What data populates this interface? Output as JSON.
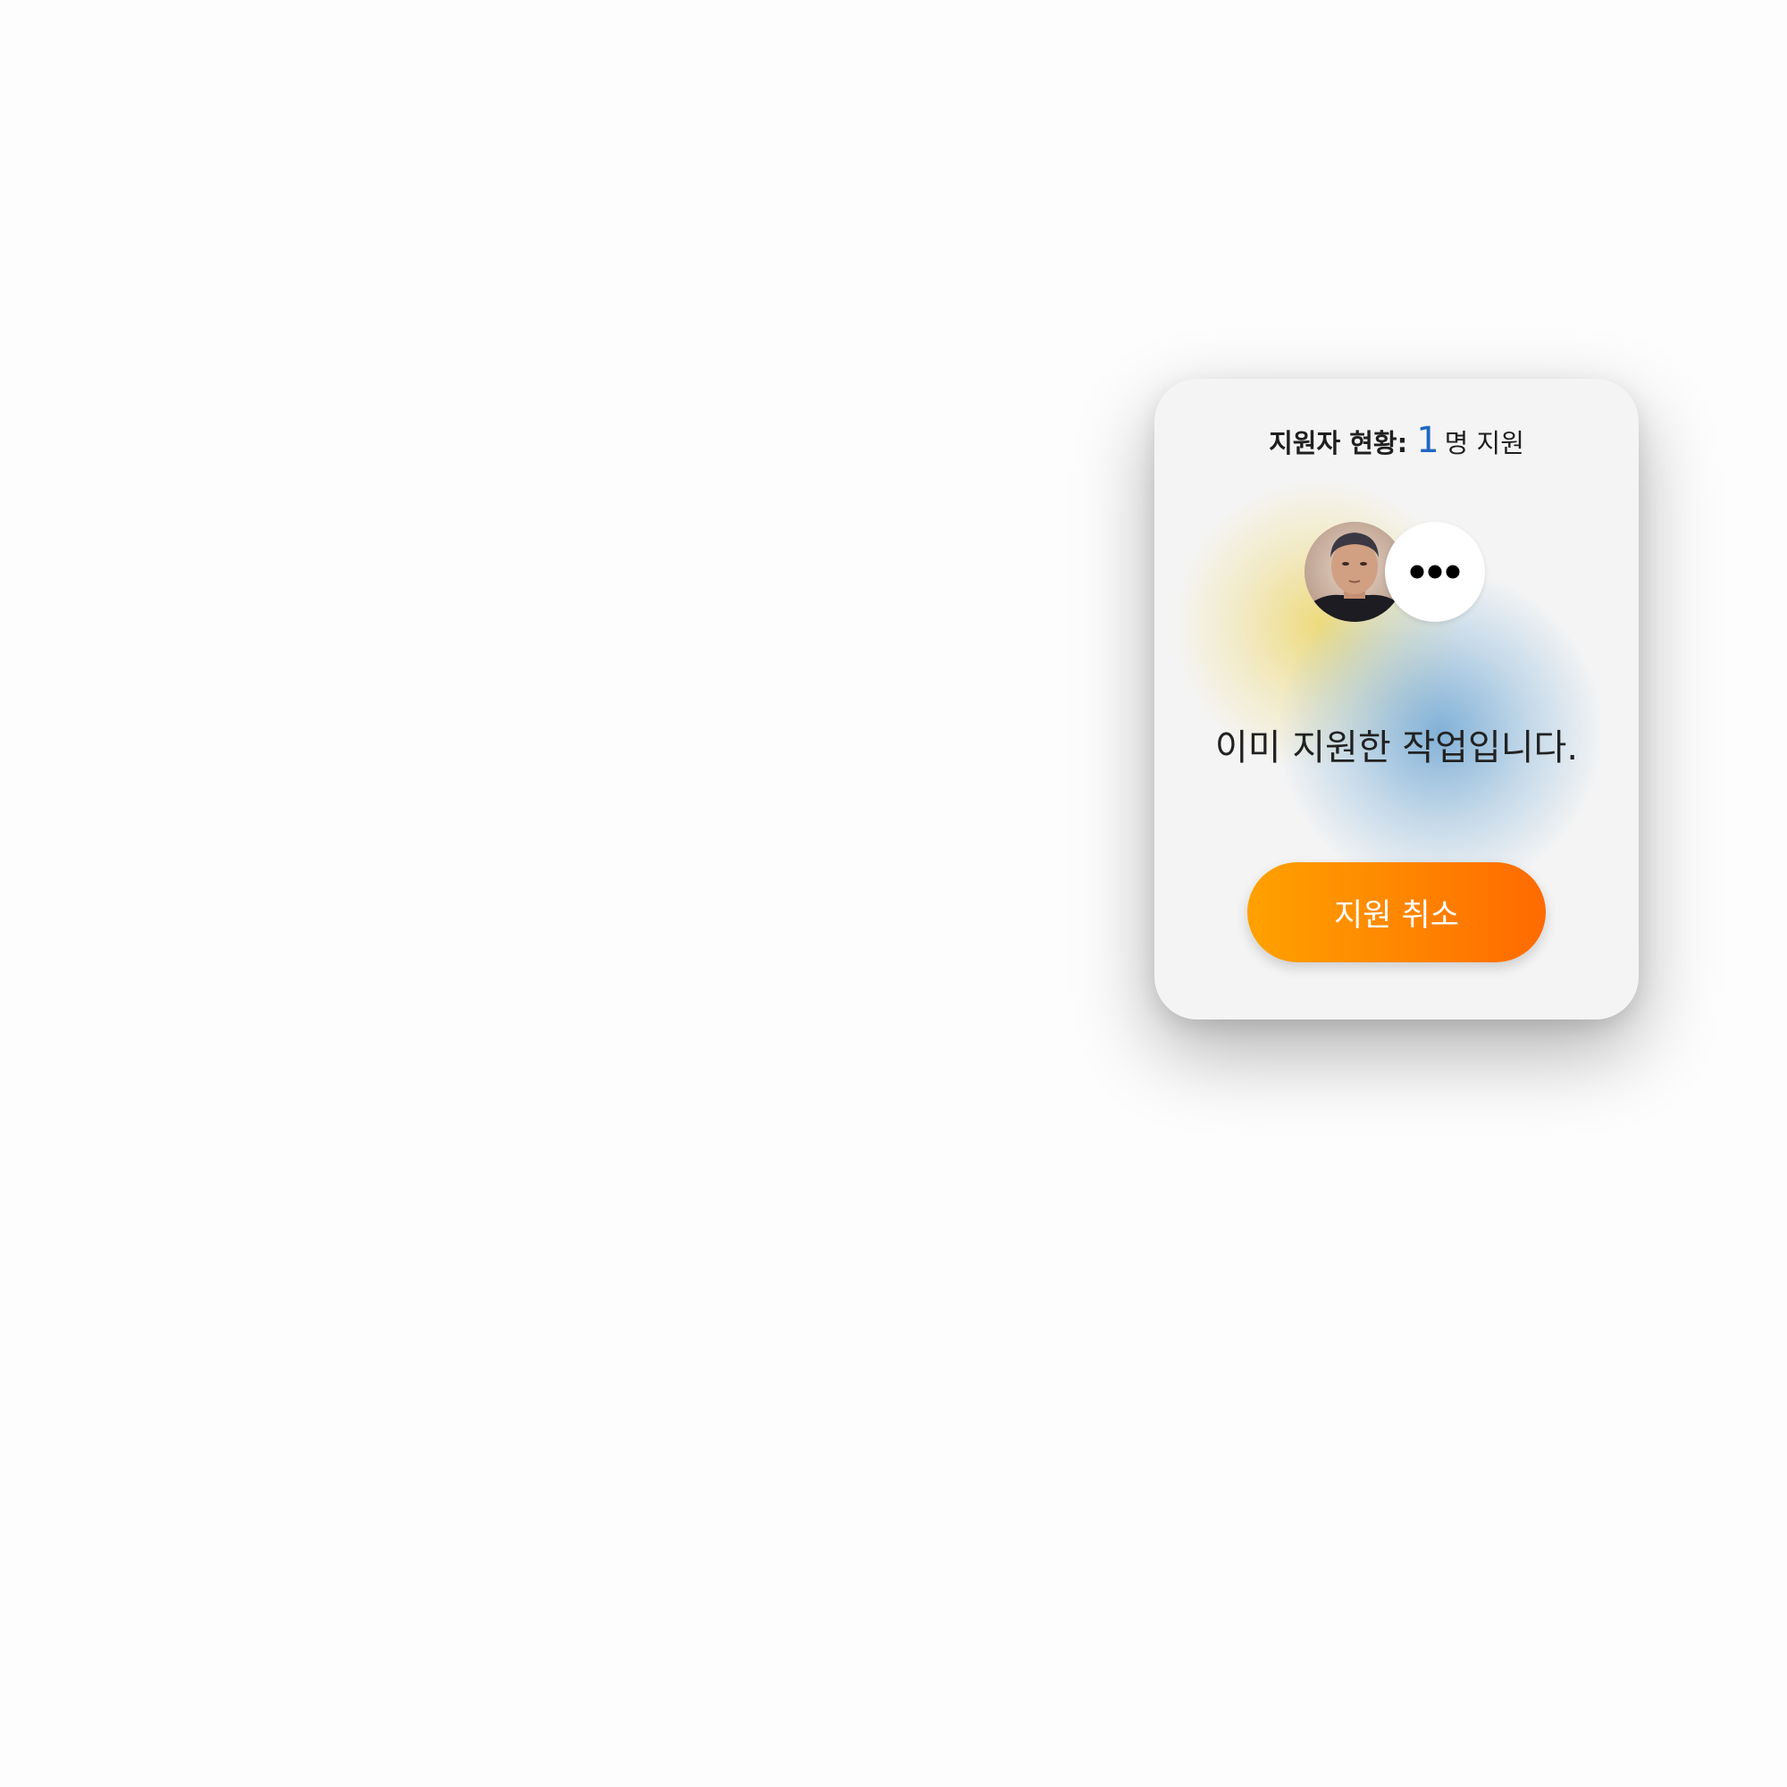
{
  "applicant_status": {
    "label": "지원자 현황:",
    "count": "1",
    "unit": "명 지원"
  },
  "avatar": {
    "alt": "지원자 프로필 사진"
  },
  "more_button": {
    "icon": "more-horizontal-icon"
  },
  "message": "이미 지원한 작업입니다.",
  "cancel_button": {
    "label": "지원 취소"
  },
  "colors": {
    "count": "#1f66c6",
    "button_start": "#ffa100",
    "button_end": "#ff6a00",
    "card_bg": "#f4f4f4"
  }
}
